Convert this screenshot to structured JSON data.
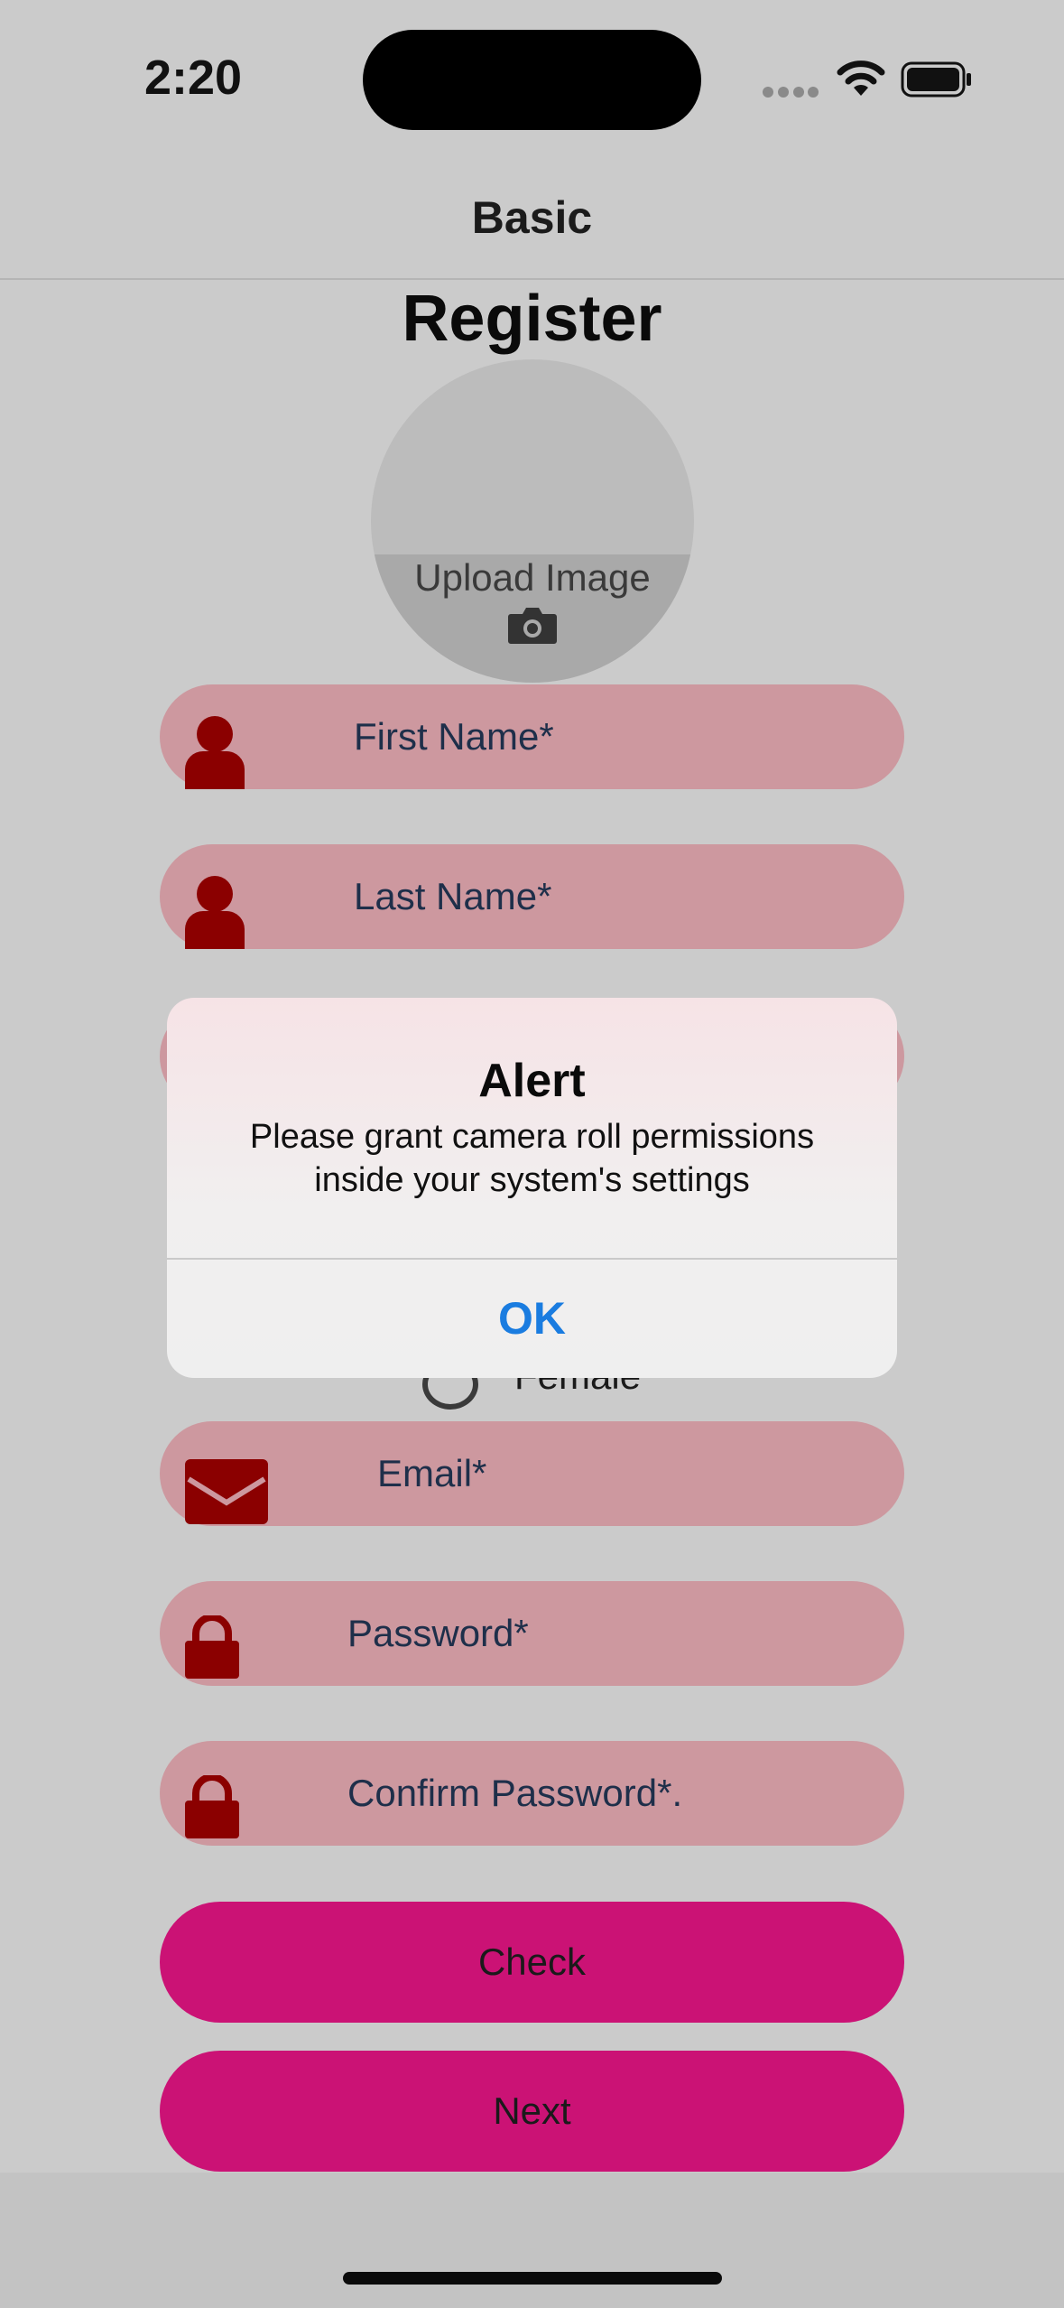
{
  "status_bar": {
    "time": "2:20"
  },
  "nav": {
    "title": "Basic"
  },
  "page": {
    "title": "Register"
  },
  "avatar": {
    "label": "Upload Image"
  },
  "form": {
    "first_name_placeholder": "First Name*",
    "last_name_placeholder": "Last Name*",
    "gender_female_label": "Female",
    "email_placeholder": "Email*",
    "password_placeholder": "Password*",
    "confirm_password_placeholder": "Confirm Password*.",
    "check_label": "Check",
    "next_label": "Next"
  },
  "alert": {
    "title": "Alert",
    "message": "Please grant camera roll permissions inside your system's settings",
    "ok_label": "OK"
  },
  "colors": {
    "field_bg": "#cd989f",
    "icon_color": "#8b0000",
    "button_bg": "#cb1275",
    "alert_link": "#1a7ce0"
  },
  "icons": [
    "wifi-icon",
    "battery-icon",
    "camera-icon",
    "person-icon",
    "envelope-icon",
    "lock-icon"
  ]
}
